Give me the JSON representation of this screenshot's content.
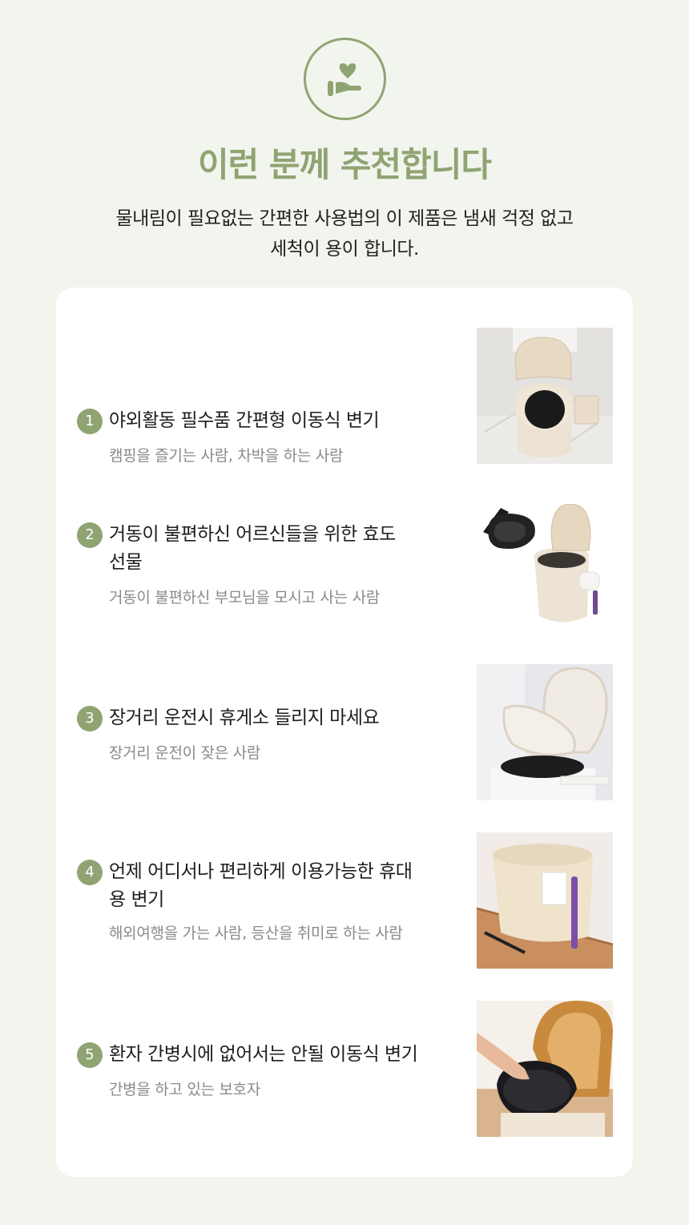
{
  "header": {
    "icon": "heart-hand-icon",
    "title": "이런 분께 추천합니다",
    "subtitle_line1": "물내림이 필요없는 간편한 사용법의 이 제품은 냄새 걱정 없고",
    "subtitle_line2": "세척이 용이 합니다."
  },
  "colors": {
    "accent": "#8fa472",
    "background": "#f2f5ee",
    "card": "#ffffff"
  },
  "items": [
    {
      "number": "1",
      "heading": "야외활동 필수품 간편형 이동식 변기",
      "desc": "캠핑을 즐기는 사람, 차박을 하는 사람"
    },
    {
      "number": "2",
      "heading": "거동이 불편하신 어르신들을 위한 효도선물",
      "desc": "거동이 불편하신 부모님을 모시고 사는 사람"
    },
    {
      "number": "3",
      "heading": "장거리 운전시 휴게소 들리지 마세요",
      "desc": "장거리 운전이 잦은 사람"
    },
    {
      "number": "4",
      "heading": "언제 어디서나 편리하게 이용가능한 휴대용 변기",
      "desc": "해외여행을 가는 사람, 등산을 취미로 하는 사람"
    },
    {
      "number": "5",
      "heading": "환자 간병시에 없어서는 안될 이동식 변기",
      "desc": "간병을 하고 있는 보호자"
    }
  ]
}
